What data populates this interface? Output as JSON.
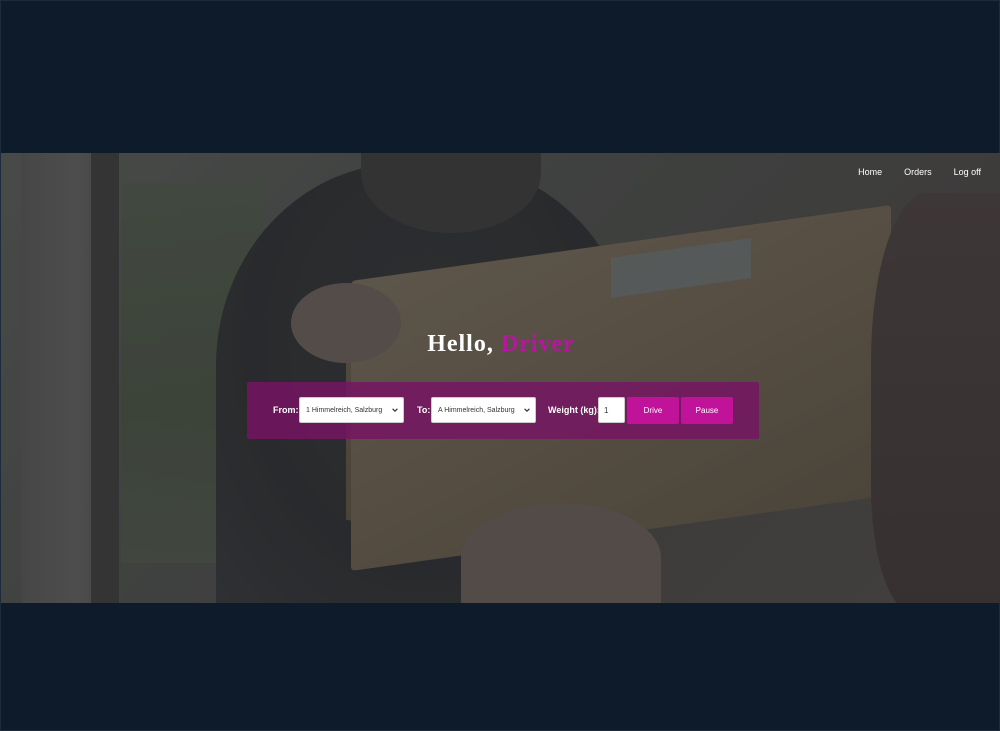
{
  "nav": {
    "home": "Home",
    "orders": "Orders",
    "logoff": "Log off"
  },
  "greeting": {
    "prefix": "Hello,",
    "name": "Driver"
  },
  "form": {
    "from_label": "From:",
    "from_value": "1 Himmelreich, Salzburg",
    "to_label": "To:",
    "to_value": "A Himmelreich, Salzburg",
    "weight_label": "Weight (kg):",
    "weight_value": "1",
    "drive_label": "Drive",
    "pause_label": "Pause"
  },
  "colors": {
    "background": "#0d1b2a",
    "accent": "#b5179e",
    "button": "#c0139a",
    "panel": "#78146a"
  },
  "icons": {
    "select_chevron": "chevron-down-icon"
  }
}
